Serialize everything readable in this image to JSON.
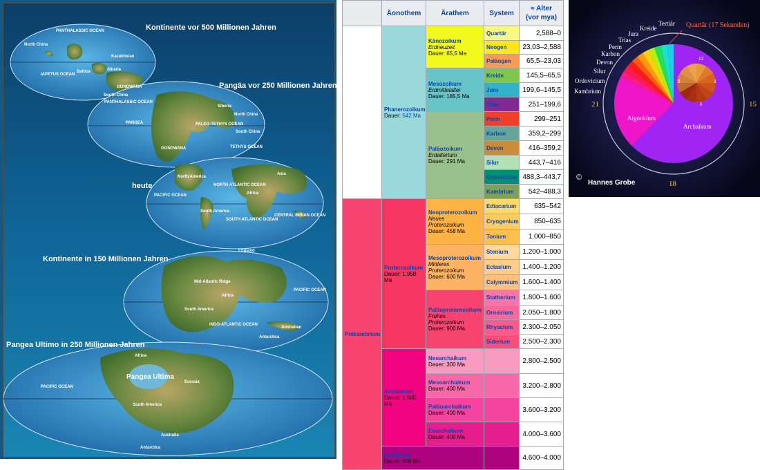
{
  "maps": [
    {
      "title": "Kontinente vor 500 Millionen Jahren",
      "labels": [
        "PANTHALASSIC OCEAN",
        "North China",
        "Siberia",
        "IAPETUS OCEAN",
        "Kazakhstan",
        "Baltica",
        "GONDWANA",
        "South China"
      ]
    },
    {
      "title": "Pangäa vor 250 Millionen Jahren",
      "labels": [
        "PANTHALASSIC OCEAN",
        "PANGEA",
        "PALEO-TETHYS OCEAN",
        "GONDWANA",
        "TETHYS OCEAN",
        "Siberia",
        "North China",
        "South China"
      ]
    },
    {
      "title": "heute",
      "labels": [
        "PACIFIC OCEAN",
        "NORTH ATLANTIC OCEAN",
        "SOUTH ATLANTIC OCEAN",
        "CENTRAL INDIAN OCEAN",
        "North America",
        "South America",
        "Africa",
        "Asia"
      ]
    },
    {
      "title": "Kontinente in 150 Millionen Jahren",
      "labels": [
        "England",
        "Mid-Atlantic Ridge",
        "PACIFIC OCEAN",
        "INDO-ATLANTIC OCEAN",
        "South America",
        "Africa",
        "Australian",
        "Antarctica"
      ]
    },
    {
      "title": "Pangea Ultimo in 250 Millionen Jahren",
      "labels": [
        "PACIFIC OCEAN",
        "Pangea Ultima",
        "Africa",
        "South America",
        "Australia",
        "Antarctica",
        "Eurasia"
      ]
    }
  ],
  "table": {
    "headers": [
      "Äonothem",
      "Ärathem",
      "System",
      "≈ Alter (vor mya)"
    ],
    "age_header_main": "≈ Alter",
    "age_header_sub": "(vor mya)",
    "eons": [
      {
        "name": "Phanerozoikum",
        "dauer_label": "Dauer:",
        "dauer": "542 Ma"
      },
      {
        "name": "Präkambrium",
        "dauer_label": "",
        "dauer": ""
      }
    ],
    "eras": [
      {
        "name": "Känozoikum",
        "sub1": "Erdneuzeit",
        "sub2": "",
        "dauer": "Dauer: 65,5 Ma"
      },
      {
        "name": "Mesozoikum",
        "sub1": "Erdmittelalter",
        "sub2": "",
        "dauer": "Dauer: 185,5 Ma"
      },
      {
        "name": "Paläozoikum",
        "sub1": "Erdaltertum",
        "sub2": "",
        "dauer": "Dauer: 291 Ma"
      },
      {
        "name": "Neoproterozoikum",
        "sub1": "Neues",
        "sub2": "Proterozoikum",
        "dauer": "Dauer: 458 Ma"
      },
      {
        "name": "Mesoproterozoikum",
        "sub1": "Mittleres",
        "sub2": "Proterozoikum",
        "dauer": "Dauer: 600 Ma"
      },
      {
        "name": "Paläoproterozoikum",
        "sub1": "Frühes",
        "sub2": "Proterozoikum",
        "dauer": "Dauer: 900 Ma"
      },
      {
        "name": "Neoarchaikum",
        "sub1": "",
        "sub2": "",
        "dauer": "Dauer: 300 Ma"
      },
      {
        "name": "Mesoarchaikum",
        "sub1": "",
        "sub2": "",
        "dauer": "Dauer: 400 Ma"
      },
      {
        "name": "Paläoarchaikum",
        "sub1": "",
        "sub2": "",
        "dauer": "Dauer: 400 Ma"
      },
      {
        "name": "Eoarchaikum",
        "sub1": "",
        "sub2": "",
        "dauer": "Dauer: 400 Ma"
      },
      {
        "name": "Hadaikum",
        "sub1": "",
        "sub2": "",
        "dauer": "Dauer: 600 Ma"
      }
    ],
    "proterozoikum": {
      "name": "Proterozoikum",
      "dauer": "Dauer: 1.958 Ma"
    },
    "archaikum": {
      "name": "Archaikum",
      "dauer": "Dauer: 1.500 Ma"
    },
    "systems": [
      {
        "name": "Quartär",
        "age": "2,588–0"
      },
      {
        "name": "Neogen",
        "age": "23,03–2,588"
      },
      {
        "name": "Paläogen",
        "age": "65,5–23,03"
      },
      {
        "name": "Kreide",
        "age": "145,5–65,5"
      },
      {
        "name": "Jura",
        "age": "199,6–145,5"
      },
      {
        "name": "Trias",
        "age": "251–199,6"
      },
      {
        "name": "Perm",
        "age": "299–251"
      },
      {
        "name": "Karbon",
        "age": "359,2–299"
      },
      {
        "name": "Devon",
        "age": "416–359,2"
      },
      {
        "name": "Silur",
        "age": "443,7–416"
      },
      {
        "name": "Ordovizium",
        "age": "488,3–443,7"
      },
      {
        "name": "Kambrium",
        "age": "542–488,3"
      },
      {
        "name": "Ediacarium",
        "age": "635–542"
      },
      {
        "name": "Cryogenium",
        "age": "850–635"
      },
      {
        "name": "Tonium",
        "age": "1.000–850"
      },
      {
        "name": "Stenium",
        "age": "1.200–1.000"
      },
      {
        "name": "Ectasium",
        "age": "1.400–1.200"
      },
      {
        "name": "Calymmium",
        "age": "1.600–1.400"
      },
      {
        "name": "Statherium",
        "age": "1.800–1.600"
      },
      {
        "name": "Orosirium",
        "age": "2.050–1.800"
      },
      {
        "name": "Rhyacium",
        "age": "2.300–2.050"
      },
      {
        "name": "Siderium",
        "age": "2.500–2.300"
      },
      {
        "name": "",
        "age": "2.800–2.500"
      },
      {
        "name": "",
        "age": "3.200–2.800"
      },
      {
        "name": "",
        "age": "3.600–3.200"
      },
      {
        "name": "",
        "age": "4.000–3.600"
      },
      {
        "name": "",
        "age": "4.600–4.000"
      }
    ]
  },
  "clock": {
    "periods": [
      "Kambrium",
      "Ordovicium",
      "Silur",
      "Devon",
      "Karbon",
      "Perm",
      "Trias",
      "Jura",
      "Kreide",
      "Tertiär"
    ],
    "quartaer_label": "Quartär (17 Sekunden)",
    "algonkium": "Algonkium",
    "archaikum": "Archaikum",
    "numbers": [
      "21",
      "15",
      "18"
    ],
    "inner_numbers": [
      "12",
      "3",
      "6",
      "9"
    ],
    "copyright_symbol": "©",
    "author": "Hannes Grobe"
  }
}
